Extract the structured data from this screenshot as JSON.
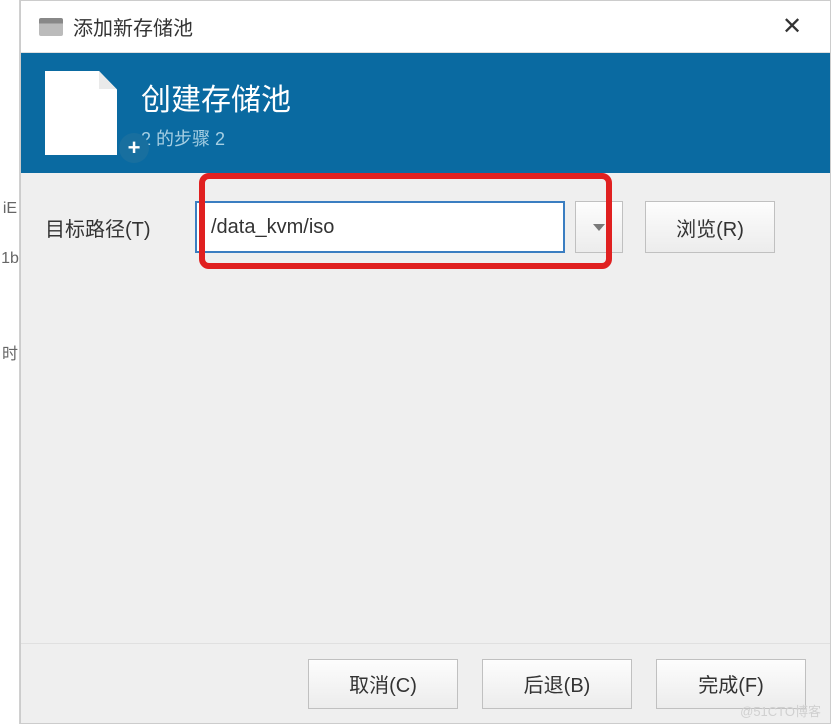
{
  "left_slice": {
    "items": [
      "iE",
      "1b",
      "时"
    ]
  },
  "titlebar": {
    "title": "添加新存储池",
    "close_glyph": "✕"
  },
  "banner": {
    "title": "创建存储池",
    "subtitle": "2 的步骤 2",
    "plus_glyph": "+"
  },
  "form": {
    "target_path_label": "目标路径(T)",
    "target_path_value": "/data_kvm/iso",
    "browse_label": "浏览(R)"
  },
  "footer": {
    "cancel_label": "取消(C)",
    "back_label": "后退(B)",
    "finish_label": "完成(F)"
  },
  "watermark": "@51CTO博客"
}
